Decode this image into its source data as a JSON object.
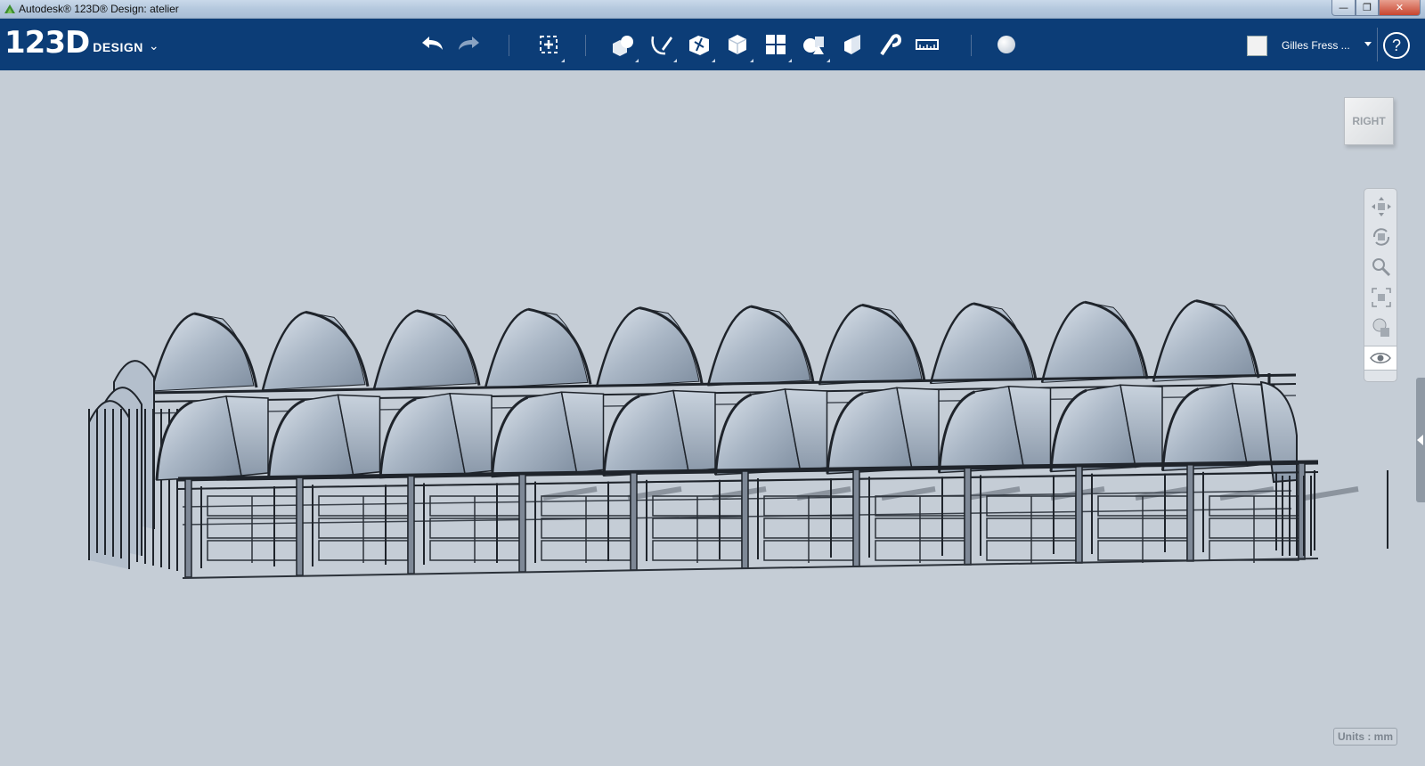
{
  "window": {
    "title": "Autodesk® 123D® Design: atelier",
    "controls": {
      "minimize": "—",
      "maximize": "❐",
      "close": "✕"
    }
  },
  "toolbar": {
    "logo_number": "123D",
    "logo_text": "DESIGN",
    "logo_chevron": "⌄",
    "buttons": [
      {
        "name": "undo-icon"
      },
      {
        "name": "redo-icon"
      },
      {
        "name": "transform-icon"
      },
      {
        "name": "primitives-icon"
      },
      {
        "name": "sketch-icon"
      },
      {
        "name": "construct-icon"
      },
      {
        "name": "modify-icon"
      },
      {
        "name": "pattern-icon"
      },
      {
        "name": "group-icon"
      },
      {
        "name": "combine-icon"
      },
      {
        "name": "snap-icon"
      },
      {
        "name": "measure-icon"
      },
      {
        "name": "material-icon"
      }
    ]
  },
  "user": {
    "name": "Gilles Fress ...",
    "help": "?"
  },
  "viewport": {
    "viewcube_label": "RIGHT",
    "units_label": "Units : mm",
    "nav_tools": [
      "pan-icon",
      "orbit-icon",
      "zoom-icon",
      "fit-icon",
      "view-mode-icon",
      "visibility-icon"
    ]
  },
  "colors": {
    "toolbar_bg": "#0c3d77",
    "viewport_bg": "#c5cdd6",
    "roof": "#a9b6c5",
    "frame": "#1f242b"
  }
}
